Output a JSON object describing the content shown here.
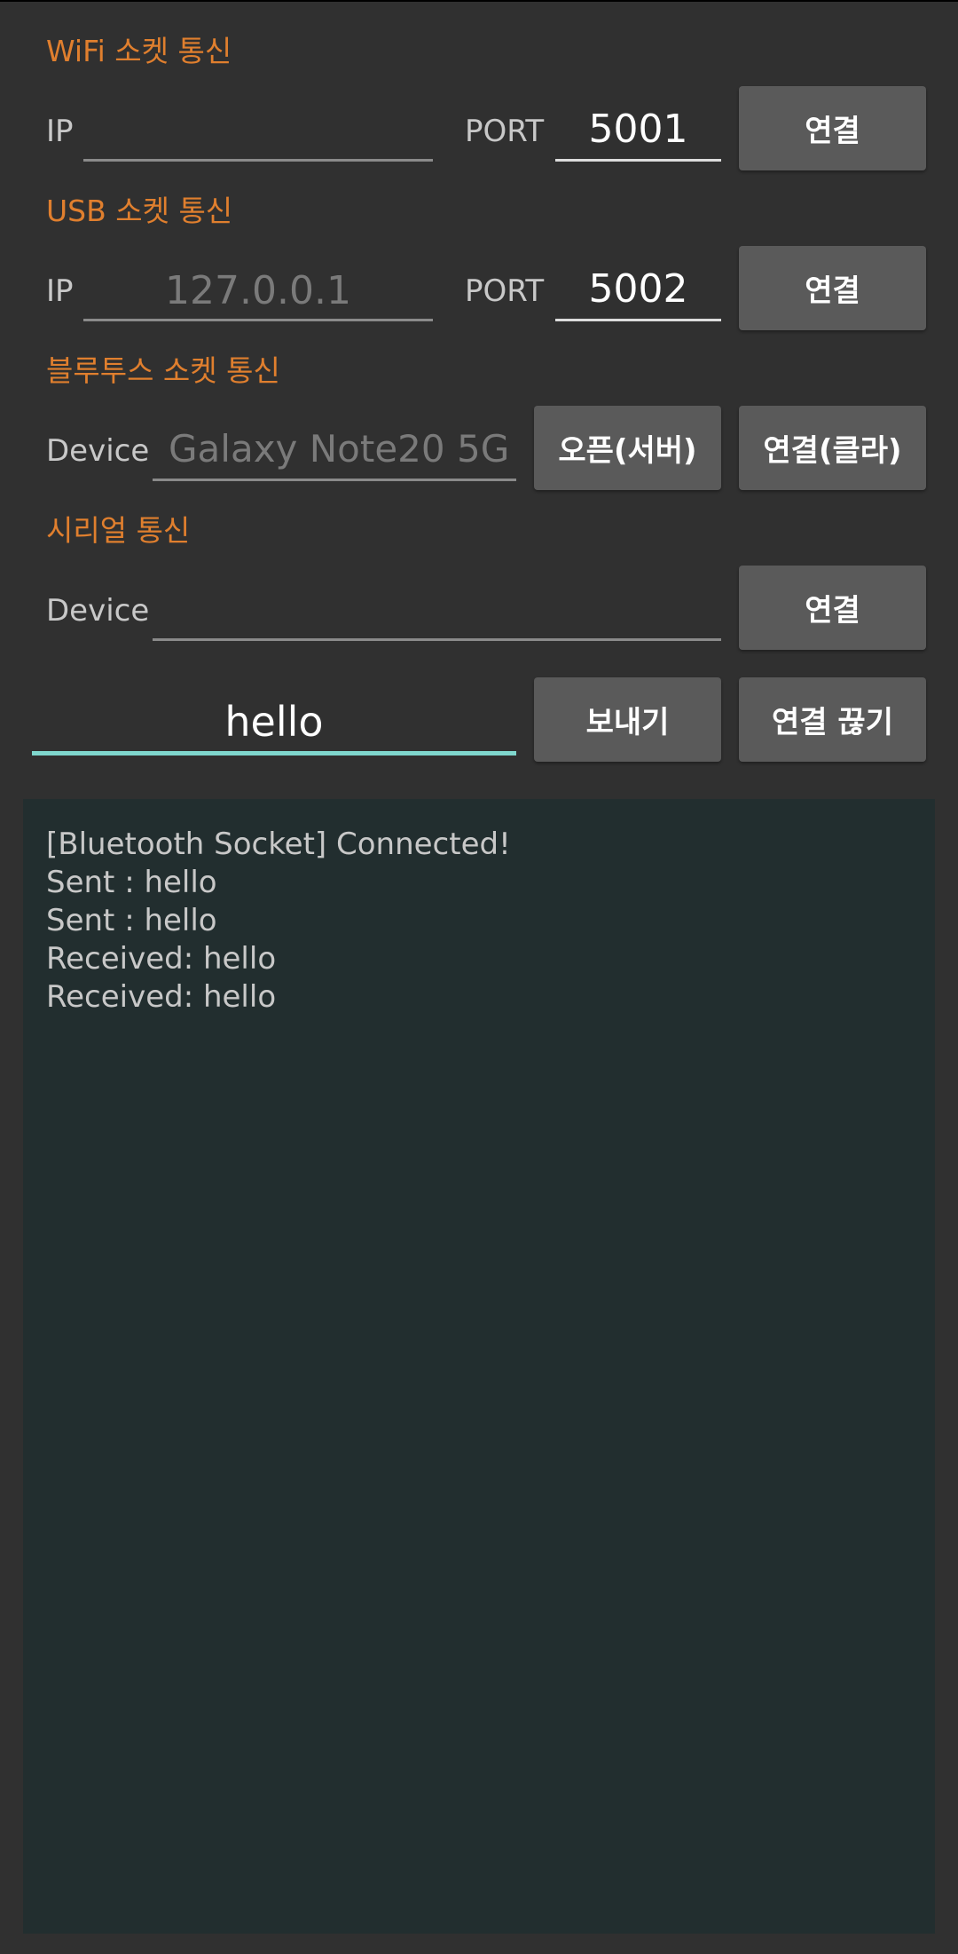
{
  "wifi": {
    "title": "WiFi 소켓 통신",
    "ip_label": "IP",
    "ip_value": "",
    "port_label": "PORT",
    "port_value": "5001",
    "connect_label": "연결"
  },
  "usb": {
    "title": "USB 소켓 통신",
    "ip_label": "IP",
    "ip_placeholder": "127.0.0.1",
    "port_label": "PORT",
    "port_value": "5002",
    "connect_label": "연결"
  },
  "bluetooth": {
    "title": "블루투스 소켓 통신",
    "device_label": "Device",
    "device_placeholder": "Galaxy Note20 5G",
    "open_server_label": "오픈(서버)",
    "connect_client_label": "연결(클라)"
  },
  "serial": {
    "title": "시리얼 통신",
    "device_label": "Device",
    "device_value": "",
    "connect_label": "연결"
  },
  "message": {
    "input_value": "hello",
    "send_label": "보내기",
    "disconnect_label": "연결 끊기"
  },
  "log": {
    "lines": [
      "[Bluetooth Socket] Connected!",
      "Sent : hello",
      "Sent : hello",
      "Received: hello",
      "Received: hello"
    ]
  },
  "colors": {
    "background": "#303030",
    "section_title": "#e07f2e",
    "button": "#5a5a5a",
    "input_focus": "#7fd7cd",
    "log_background": "#222e2f"
  }
}
